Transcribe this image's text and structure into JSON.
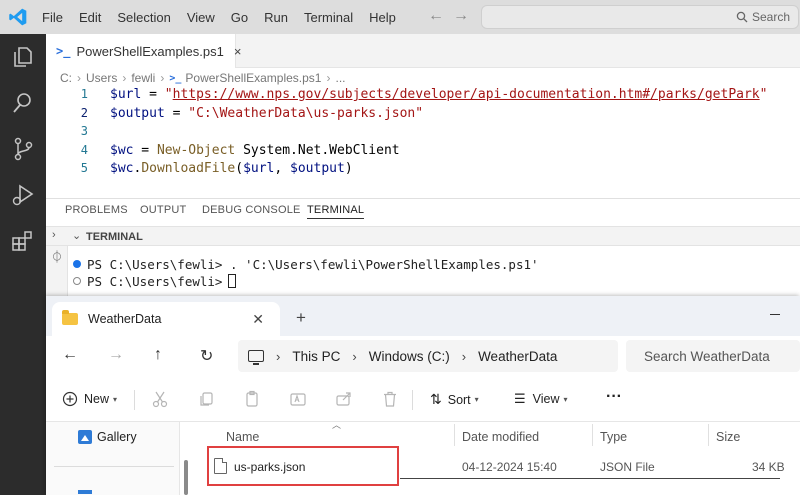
{
  "vscode": {
    "menu": [
      "File",
      "Edit",
      "Selection",
      "View",
      "Go",
      "Run",
      "Terminal",
      "Help"
    ],
    "search_label": "Search",
    "tab": {
      "icon": "powershell-icon",
      "label": "PowerShellExamples.ps1",
      "close": "×"
    },
    "breadcrumb": [
      "C:",
      "Users",
      "fewli",
      "PowerShellExamples.ps1",
      "..."
    ],
    "code_lines": [
      {
        "num": "1",
        "tokens": [
          {
            "t": "$url",
            "c": "var"
          },
          {
            "t": " = ",
            "c": "op"
          },
          {
            "t": "\"",
            "c": "str"
          },
          {
            "t": "https://www.nps.gov/subjects/developer/api-documentation.htm#/parks/getPark",
            "c": "url"
          },
          {
            "t": "\"",
            "c": "str"
          }
        ]
      },
      {
        "num": "2",
        "tokens": [
          {
            "t": "$output",
            "c": "var"
          },
          {
            "t": " = ",
            "c": "op"
          },
          {
            "t": "\"C:\\WeatherData\\us-parks.json\"",
            "c": "str"
          }
        ]
      },
      {
        "num": "3",
        "tokens": []
      },
      {
        "num": "4",
        "tokens": [
          {
            "t": "$wc",
            "c": "var"
          },
          {
            "t": " = ",
            "c": "op"
          },
          {
            "t": "New-Object",
            "c": "cmd"
          },
          {
            "t": " System.Net.WebClient",
            "c": "plain"
          }
        ]
      },
      {
        "num": "5",
        "tokens": [
          {
            "t": "$wc",
            "c": "var"
          },
          {
            "t": ".",
            "c": "plain"
          },
          {
            "t": "DownloadFile",
            "c": "cmd"
          },
          {
            "t": "(",
            "c": "plain"
          },
          {
            "t": "$url",
            "c": "var"
          },
          {
            "t": ", ",
            "c": "plain"
          },
          {
            "t": "$output",
            "c": "var"
          },
          {
            "t": ")",
            "c": "plain"
          }
        ]
      }
    ],
    "panel_tabs": [
      "PROBLEMS",
      "OUTPUT",
      "DEBUG CONSOLE",
      "TERMINAL"
    ],
    "active_panel": "TERMINAL",
    "terminal_title": "TERMINAL",
    "terminal_lines": [
      {
        "text": "PS C:\\Users\\fewli> . 'C:\\Users\\fewli\\PowerShellExamples.ps1'",
        "dot": "filled"
      },
      {
        "text": "PS C:\\Users\\fewli>",
        "dot": "hollow",
        "cursor": true
      }
    ]
  },
  "explorer": {
    "tab_label": "WeatherData",
    "address": [
      "This PC",
      "Windows (C:)",
      "WeatherData"
    ],
    "search_placeholder": "Search WeatherData",
    "toolbar": {
      "new_label": "New",
      "sort_label": "Sort",
      "view_label": "View",
      "more_label": "···"
    },
    "nav": {
      "gallery_label": "Gallery"
    },
    "columns": [
      "Name",
      "Date modified",
      "Type",
      "Size"
    ],
    "files": [
      {
        "name": "us-parks.json",
        "date": "04-12-2024 15:40",
        "type": "JSON File",
        "size": "34 KB"
      }
    ],
    "highlight_color": "#e04040"
  }
}
